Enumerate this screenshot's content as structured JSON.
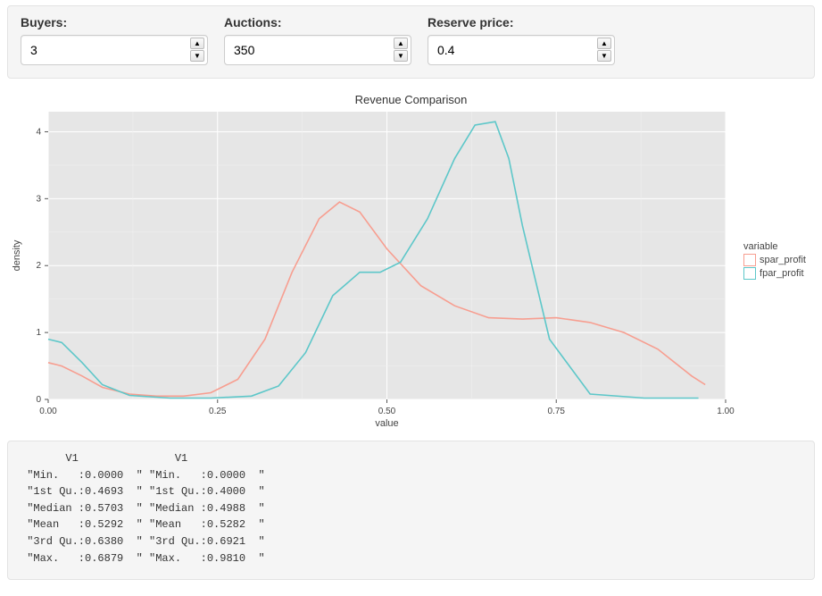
{
  "controls": {
    "buyers": {
      "label": "Buyers:",
      "value": "3"
    },
    "auctions": {
      "label": "Auctions:",
      "value": "350"
    },
    "reserve_price": {
      "label": "Reserve price:",
      "value": "0.4"
    }
  },
  "chart_data": {
    "type": "line",
    "title": "Revenue Comparison",
    "xlabel": "value",
    "ylabel": "density",
    "xlim": [
      0.0,
      1.0
    ],
    "ylim": [
      0.0,
      4.3
    ],
    "x_ticks": [
      0.0,
      0.25,
      0.5,
      0.75,
      1.0
    ],
    "y_ticks": [
      0,
      1,
      2,
      3,
      4
    ],
    "legend_title": "variable",
    "colors": {
      "spar_profit": "#f79e90",
      "fpar_profit": "#5dc7c9"
    },
    "series": [
      {
        "name": "spar_profit",
        "x": [
          0.0,
          0.02,
          0.05,
          0.08,
          0.12,
          0.16,
          0.2,
          0.24,
          0.28,
          0.32,
          0.36,
          0.4,
          0.43,
          0.46,
          0.5,
          0.55,
          0.6,
          0.65,
          0.7,
          0.75,
          0.8,
          0.85,
          0.9,
          0.95,
          0.97
        ],
        "y": [
          0.55,
          0.5,
          0.35,
          0.18,
          0.08,
          0.05,
          0.05,
          0.1,
          0.3,
          0.9,
          1.9,
          2.7,
          2.95,
          2.8,
          2.25,
          1.7,
          1.4,
          1.22,
          1.2,
          1.22,
          1.15,
          1.0,
          0.75,
          0.35,
          0.22
        ]
      },
      {
        "name": "fpar_profit",
        "x": [
          0.0,
          0.02,
          0.05,
          0.08,
          0.12,
          0.18,
          0.24,
          0.3,
          0.34,
          0.38,
          0.42,
          0.46,
          0.49,
          0.52,
          0.56,
          0.6,
          0.63,
          0.66,
          0.68,
          0.7,
          0.74,
          0.8,
          0.88,
          0.96
        ],
        "y": [
          0.9,
          0.85,
          0.55,
          0.22,
          0.06,
          0.02,
          0.02,
          0.05,
          0.2,
          0.7,
          1.55,
          1.9,
          1.9,
          2.05,
          2.7,
          3.6,
          4.1,
          4.15,
          3.6,
          2.6,
          0.9,
          0.08,
          0.02,
          0.02
        ]
      }
    ]
  },
  "legend": {
    "items": [
      {
        "name": "spar_profit"
      },
      {
        "name": "fpar_profit"
      }
    ]
  },
  "stats": {
    "header_left": "V1",
    "header_right": "V1",
    "rows": [
      {
        "l": "\"Min.   :0.0000  \"",
        "r": "\"Min.   :0.0000  \""
      },
      {
        "l": "\"1st Qu.:0.4693  \"",
        "r": "\"1st Qu.:0.4000  \""
      },
      {
        "l": "\"Median :0.5703  \"",
        "r": "\"Median :0.4988  \""
      },
      {
        "l": "\"Mean   :0.5292  \"",
        "r": "\"Mean   :0.5282  \""
      },
      {
        "l": "\"3rd Qu.:0.6380  \"",
        "r": "\"3rd Qu.:0.6921  \""
      },
      {
        "l": "\"Max.   :0.6879  \"",
        "r": "\"Max.   :0.9810  \""
      }
    ]
  }
}
